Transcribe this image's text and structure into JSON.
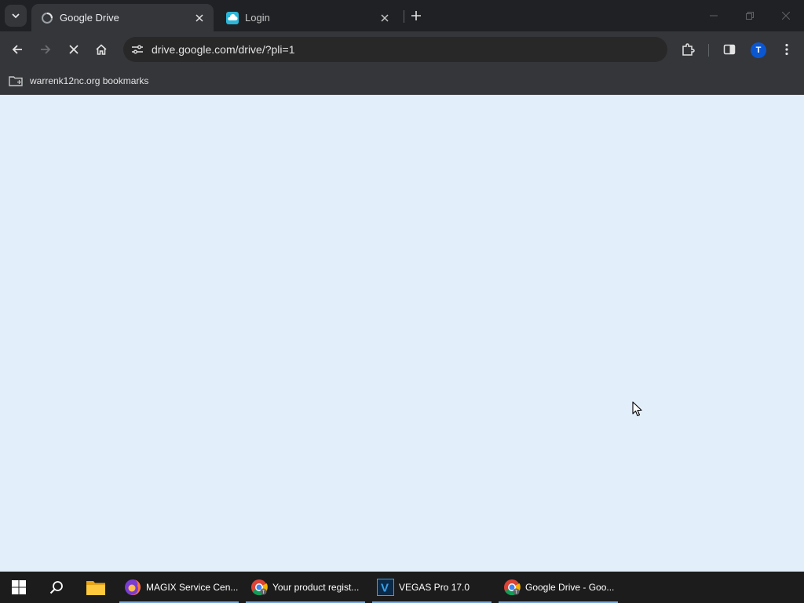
{
  "browser": {
    "tabs": [
      {
        "title": "Google Drive",
        "active": true
      },
      {
        "title": "Login",
        "active": false
      }
    ],
    "new_tab_label": "+",
    "url": "drive.google.com/drive/?pli=1",
    "profile_initial": "T",
    "bookmarks": [
      {
        "label": "warrenk12nc.org bookmarks",
        "icon": "folder-icon"
      }
    ]
  },
  "taskbar": {
    "apps": [
      {
        "label": "MAGIX Service Cen...",
        "icon": "firefox-icon"
      },
      {
        "label": "Your product regist...",
        "icon": "chrome-icon"
      },
      {
        "label": "VEGAS Pro 17.0",
        "icon": "vegas-icon"
      },
      {
        "label": "Google Drive - Goo...",
        "icon": "chrome-icon"
      }
    ]
  },
  "colors": {
    "page_background": "#e3eefb",
    "accent": "#0b57d0",
    "taskbar_underline": "#7aa7d9"
  }
}
